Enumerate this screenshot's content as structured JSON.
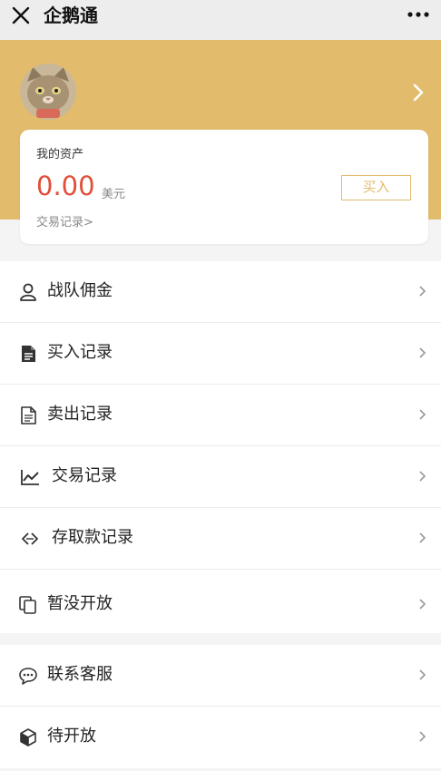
{
  "app_title": "企鹅通",
  "colors": {
    "accent": "#e2bb6c",
    "amount": "#e04f3a",
    "topbar": "#ededed"
  },
  "asset": {
    "label": "我的资产",
    "amount": "0.00",
    "unit": "美元",
    "records_link": "交易记录>",
    "buy_label": "买入"
  },
  "menu_group_1": [
    {
      "label": "战队佣金",
      "icon": "user-icon"
    },
    {
      "label": "买入记录",
      "icon": "document-filled-icon"
    },
    {
      "label": "卖出记录",
      "icon": "document-outline-icon"
    },
    {
      "label": "交易记录",
      "icon": "trend-chart-icon"
    },
    {
      "label": "存取款记录",
      "icon": "exchange-icon"
    },
    {
      "label": "暂没开放",
      "icon": "copy-icon"
    }
  ],
  "menu_group_2": [
    {
      "label": "联系客服",
      "icon": "chat-bubble-icon"
    },
    {
      "label": "待开放",
      "icon": "cube-icon"
    }
  ]
}
